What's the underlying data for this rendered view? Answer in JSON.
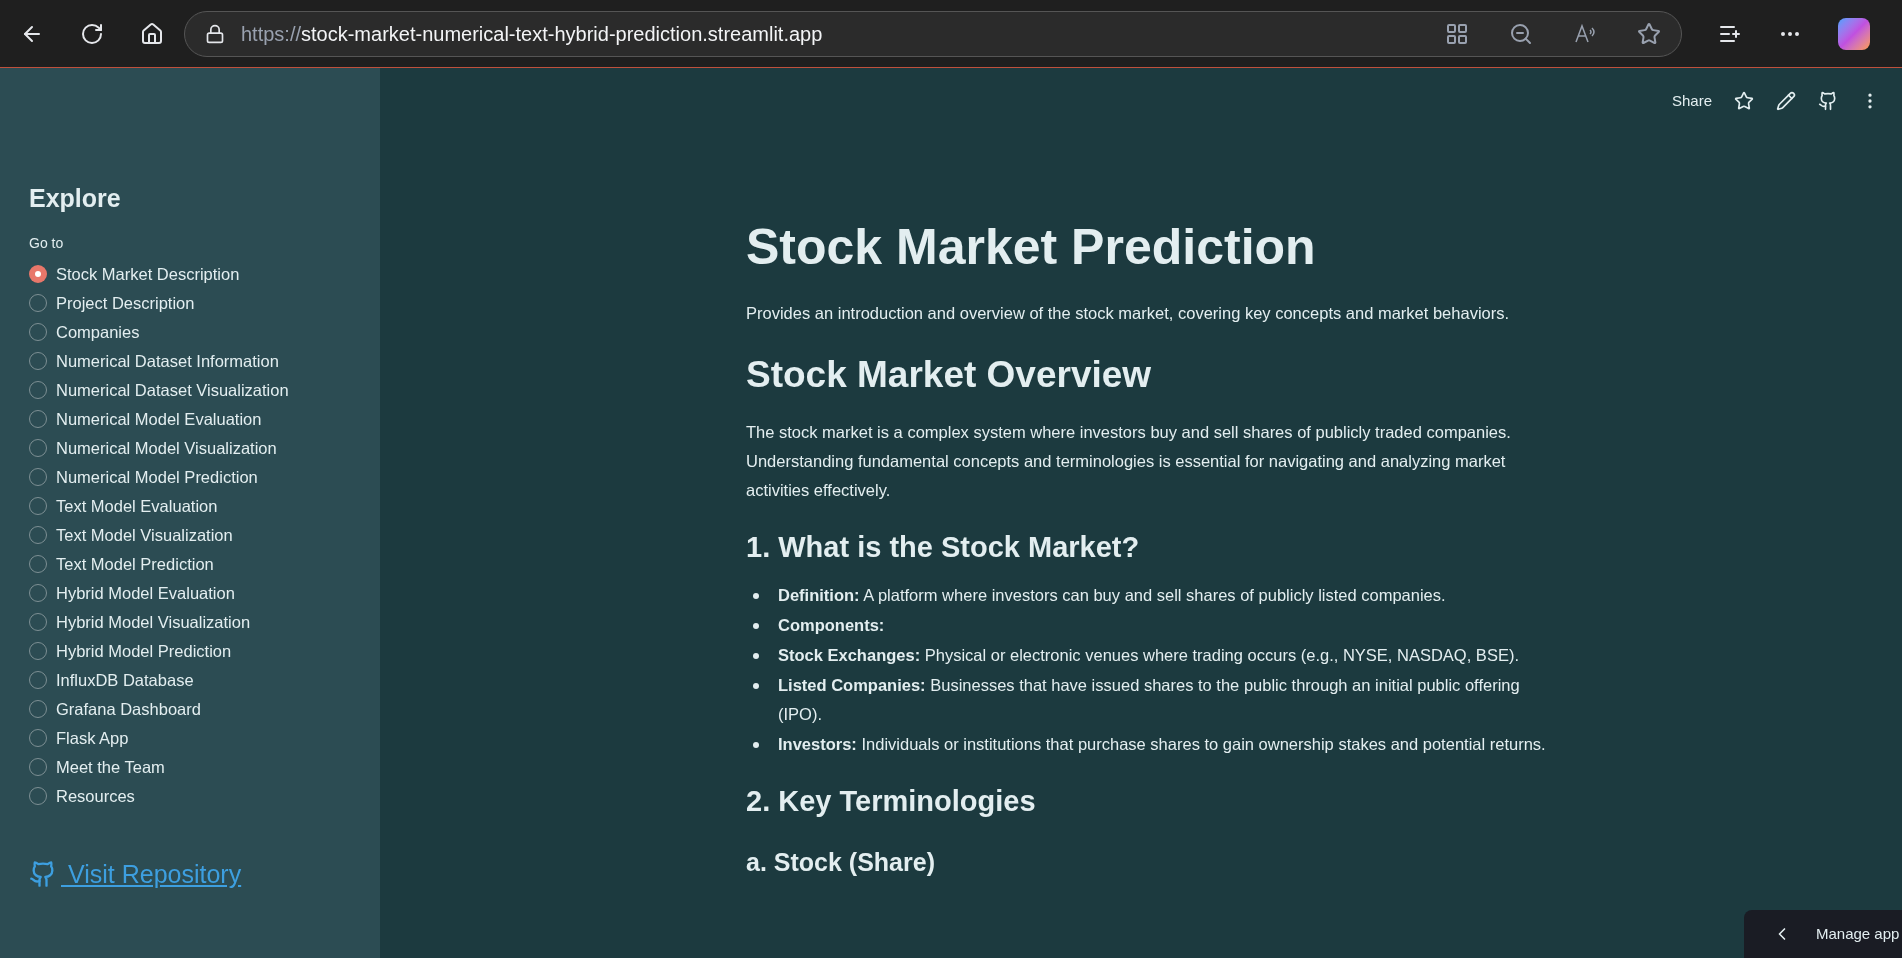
{
  "browser": {
    "url_scheme": "https://",
    "url_host": "stock-market-numerical-text-hybrid-prediction.streamlit.app"
  },
  "sidebar": {
    "title": "Explore",
    "radio_label": "Go to",
    "items": [
      {
        "label": "Stock Market Description",
        "selected": true
      },
      {
        "label": "Project Description",
        "selected": false
      },
      {
        "label": "Companies",
        "selected": false
      },
      {
        "label": "Numerical Dataset Information",
        "selected": false
      },
      {
        "label": "Numerical Dataset Visualization",
        "selected": false
      },
      {
        "label": "Numerical Model Evaluation",
        "selected": false
      },
      {
        "label": "Numerical Model Visualization",
        "selected": false
      },
      {
        "label": "Numerical Model Prediction",
        "selected": false
      },
      {
        "label": "Text Model Evaluation",
        "selected": false
      },
      {
        "label": "Text Model Visualization",
        "selected": false
      },
      {
        "label": "Text Model Prediction",
        "selected": false
      },
      {
        "label": "Hybrid Model Evaluation",
        "selected": false
      },
      {
        "label": "Hybrid Model Visualization",
        "selected": false
      },
      {
        "label": "Hybrid Model Prediction",
        "selected": false
      },
      {
        "label": "InfluxDB Database",
        "selected": false
      },
      {
        "label": "Grafana Dashboard",
        "selected": false
      },
      {
        "label": "Flask App",
        "selected": false
      },
      {
        "label": "Meet the Team",
        "selected": false
      },
      {
        "label": "Resources",
        "selected": false
      }
    ],
    "link": " Visit Repository"
  },
  "toolbar": {
    "share": "Share"
  },
  "main": {
    "blocks": [
      {
        "kind": "h1",
        "text": "Stock Market Prediction"
      },
      {
        "kind": "p",
        "text": "Provides an introduction and overview of the stock market, covering key concepts and market behaviors."
      },
      {
        "kind": "h2",
        "text": "Stock Market Overview"
      },
      {
        "kind": "p",
        "text": "The stock market is a complex system where investors buy and sell shares of publicly traded companies. Understanding fundamental concepts and terminologies is essential for navigating and analyzing market activities effectively."
      },
      {
        "kind": "h3",
        "text": "1. What is the Stock Market?"
      },
      {
        "kind": "li",
        "text": "**Definition:** A platform where investors can buy and sell shares of publicly listed companies."
      },
      {
        "kind": "li",
        "text": "**Components:**"
      },
      {
        "kind": "li",
        "text": "**Stock Exchanges:** Physical or electronic venues where trading occurs (e.g., NYSE, NASDAQ, BSE)."
      },
      {
        "kind": "li",
        "text": "**Listed Companies:** Businesses that have issued shares to the public through an initial public offering (IPO)."
      },
      {
        "kind": "li",
        "text": "**Investors:** Individuals or institutions that purchase shares to gain ownership stakes and potential returns."
      },
      {
        "kind": "h3",
        "text": "2. Key Terminologies"
      },
      {
        "kind": "h4",
        "text": "a. Stock (Share)"
      }
    ]
  },
  "manage_app": "Manage app"
}
